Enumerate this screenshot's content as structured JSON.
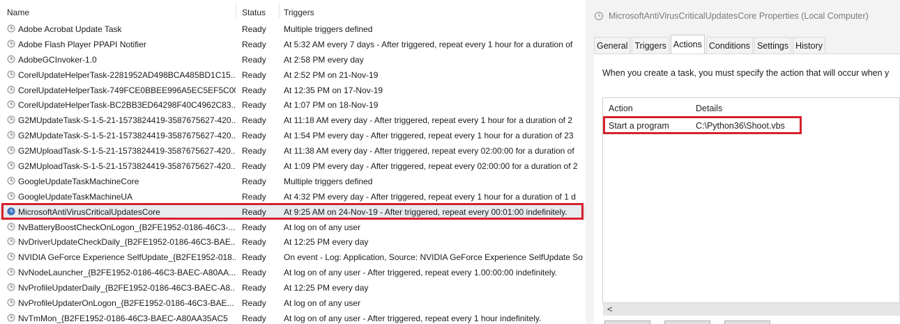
{
  "columns": {
    "name": "Name",
    "status": "Status",
    "triggers": "Triggers"
  },
  "tasks": [
    {
      "name": "Adobe Acrobat Update Task",
      "status": "Ready",
      "triggers": "Multiple triggers defined"
    },
    {
      "name": "Adobe Flash Player PPAPI Notifier",
      "status": "Ready",
      "triggers": "At 5:32 AM every 7 days - After triggered, repeat every 1 hour for a duration of"
    },
    {
      "name": "AdobeGCInvoker-1.0",
      "status": "Ready",
      "triggers": "At 2:58 PM every day"
    },
    {
      "name": "CorelUpdateHelperTask-2281952AD498BCA485BD1C15...",
      "status": "Ready",
      "triggers": "At 2:52 PM on 21-Nov-19"
    },
    {
      "name": "CorelUpdateHelperTask-749FCE0BBEE996A5EC5EF5C00...",
      "status": "Ready",
      "triggers": "At 12:35 PM on 17-Nov-19"
    },
    {
      "name": "CorelUpdateHelperTask-BC2BB3ED64298F40C4962C83...",
      "status": "Ready",
      "triggers": "At 1:07 PM on 18-Nov-19"
    },
    {
      "name": "G2MUpdateTask-S-1-5-21-1573824419-3587675627-420...",
      "status": "Ready",
      "triggers": "At 11:18 AM every day - After triggered, repeat every 1 hour for a duration of 2"
    },
    {
      "name": "G2MUpdateTask-S-1-5-21-1573824419-3587675627-420...",
      "status": "Ready",
      "triggers": "At 1:54 PM every day - After triggered, repeat every 1 hour for a duration of 23"
    },
    {
      "name": "G2MUploadTask-S-1-5-21-1573824419-3587675627-420...",
      "status": "Ready",
      "triggers": "At 11:38 AM every day - After triggered, repeat every 02:00:00 for a duration of"
    },
    {
      "name": "G2MUploadTask-S-1-5-21-1573824419-3587675627-420...",
      "status": "Ready",
      "triggers": "At 1:09 PM every day - After triggered, repeat every 02:00:00 for a duration of 2"
    },
    {
      "name": "GoogleUpdateTaskMachineCore",
      "status": "Ready",
      "triggers": "Multiple triggers defined"
    },
    {
      "name": "GoogleUpdateTaskMachineUA",
      "status": "Ready",
      "triggers": "At 4:32 PM every day - After triggered, repeat every 1 hour for a duration of 1 d"
    },
    {
      "name": "MicrosoftAntiVirusCriticalUpdatesCore",
      "status": "Ready",
      "triggers": "At 9:25 AM on 24-Nov-19 - After triggered, repeat every 00:01:00 indefinitely."
    },
    {
      "name": "NvBatteryBoostCheckOnLogon_{B2FE1952-0186-46C3-...",
      "status": "Ready",
      "triggers": "At log on of any user"
    },
    {
      "name": "NvDriverUpdateCheckDaily_{B2FE1952-0186-46C3-BAE...",
      "status": "Ready",
      "triggers": "At 12:25 PM every day"
    },
    {
      "name": "NVIDIA GeForce Experience SelfUpdate_{B2FE1952-018...",
      "status": "Ready",
      "triggers": "On event - Log: Application, Source: NVIDIA GeForce Experience SelfUpdate So"
    },
    {
      "name": "NvNodeLauncher_{B2FE1952-0186-46C3-BAEC-A80AA...",
      "status": "Ready",
      "triggers": "At log on of any user - After triggered, repeat every 1.00:00:00 indefinitely."
    },
    {
      "name": "NvProfileUpdaterDaily_{B2FE1952-0186-46C3-BAEC-A8...",
      "status": "Ready",
      "triggers": "At 12:25 PM every day"
    },
    {
      "name": "NvProfileUpdaterOnLogon_{B2FE1952-0186-46C3-BAE...",
      "status": "Ready",
      "triggers": "At log on of any user"
    },
    {
      "name": "NvTmMon_{B2FE1952-0186-46C3-BAEC-A80AA35AC5",
      "status": "Ready",
      "triggers": "At log on of any user - After triggered, repeat every 1 hour indefinitely."
    }
  ],
  "selected_task_index": 12,
  "dialog": {
    "title": "MicrosoftAntiVirusCriticalUpdatesCore Properties (Local Computer)",
    "tabs": [
      "General",
      "Triggers",
      "Actions",
      "Conditions",
      "Settings",
      "History"
    ],
    "active_tab": "Actions",
    "intro": "When you create a task, you must specify the action that will occur when y",
    "action_columns": {
      "action": "Action",
      "details": "Details"
    },
    "actions": [
      {
        "action": "Start a program",
        "details": "C:\\Python36\\Shoot.vbs"
      }
    ],
    "scroll_left": "<"
  },
  "colors": {
    "highlight": "#d7212b",
    "selected_row": "#e8eaed"
  }
}
